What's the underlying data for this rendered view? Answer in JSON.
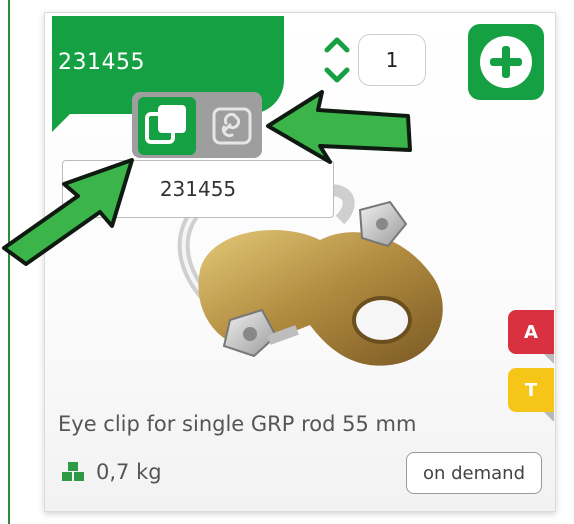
{
  "product": {
    "sku": "231455",
    "quantity": "1",
    "name": "Eye clip for single GRP rod 55 mm",
    "weight": "0,7 kg",
    "availability": "on demand",
    "sku_dropdown_value": "231455"
  },
  "badges": [
    {
      "letter": "A",
      "color": "#d9313f"
    },
    {
      "letter": "T",
      "color": "#f5c518"
    }
  ],
  "icons": {
    "quantity": "up-down-chevron-icon",
    "add": "plus-circle-icon",
    "copy": "copy-icon",
    "link": "link-icon",
    "weight": "boxes-icon"
  },
  "colors": {
    "brand_green": "#15a143",
    "toolbar_gray": "#9e9e9e",
    "arrow_green": "#3bb54a"
  }
}
